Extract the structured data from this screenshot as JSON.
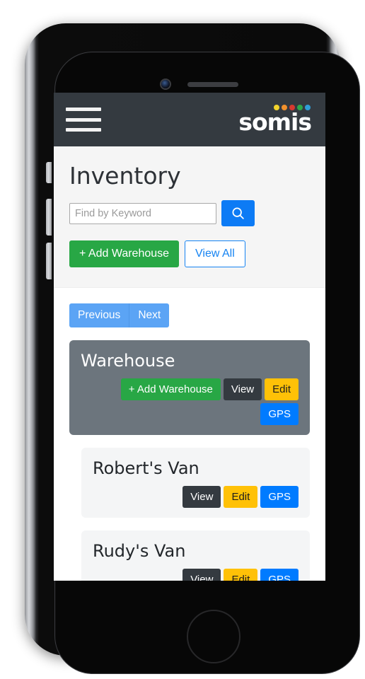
{
  "navbar": {
    "menu_icon": "hamburger-menu-icon",
    "brand_text": "somis",
    "brand_dot_colors": [
      "#f2d32c",
      "#f2912c",
      "#d8392f",
      "#2fa84a",
      "#2f9fd8"
    ]
  },
  "jumbotron": {
    "title": "Inventory",
    "search": {
      "placeholder": "Find by Keyword",
      "value": "",
      "button_icon": "search-icon"
    },
    "add_warehouse_label": "+ Add Warehouse",
    "view_all_label": "View All"
  },
  "pagination": {
    "previous_label": "Previous",
    "next_label": "Next"
  },
  "cards": [
    {
      "title": "Warehouse",
      "level": 0,
      "actions": [
        {
          "label": "+ Add Warehouse",
          "style": "act-add"
        },
        {
          "label": "View",
          "style": "act-view"
        },
        {
          "label": "Edit",
          "style": "act-edit"
        },
        {
          "label": "GPS",
          "style": "act-gps"
        }
      ]
    },
    {
      "title": "Robert's Van",
      "level": 1,
      "actions": [
        {
          "label": "View",
          "style": "act-view"
        },
        {
          "label": "Edit",
          "style": "act-edit"
        },
        {
          "label": "GPS",
          "style": "act-gps"
        }
      ]
    },
    {
      "title": "Rudy's Van",
      "level": 1,
      "actions": [
        {
          "label": "View",
          "style": "act-view"
        },
        {
          "label": "Edit",
          "style": "act-edit"
        },
        {
          "label": "GPS",
          "style": "act-gps"
        }
      ]
    }
  ],
  "device": {
    "camera_icon": "front-camera-icon",
    "speaker_icon": "earpiece-speaker-icon",
    "home_button_icon": "home-button-icon"
  }
}
